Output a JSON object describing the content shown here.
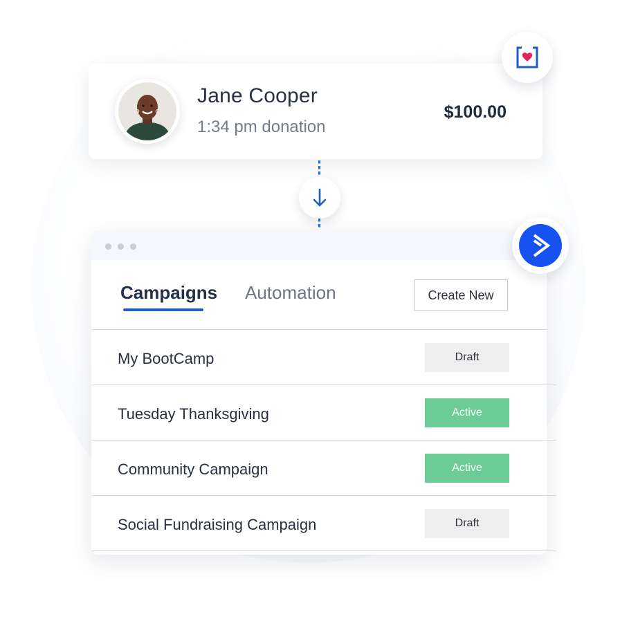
{
  "donation": {
    "donor_name": "Jane Cooper",
    "time_text": "1:34 pm donation",
    "amount": "$100.00"
  },
  "icons": {
    "donation_badge": "heart-box-icon",
    "flow_arrow": "arrow-down-icon",
    "automation_badge": "chevron-right-logo-icon",
    "window_dots": "window-dots-icon"
  },
  "tabs": [
    {
      "label": "Campaigns",
      "active": true
    },
    {
      "label": "Automation",
      "active": false
    }
  ],
  "create_button": "Create New",
  "campaigns": [
    {
      "name": "My BootCamp",
      "status": "Draft"
    },
    {
      "name": "Tuesday Thanksgiving",
      "status": "Active"
    },
    {
      "name": "Community Campaign",
      "status": "Active"
    },
    {
      "name": "Social Fundraising Campaign",
      "status": "Draft"
    }
  ],
  "colors": {
    "accent_blue": "#1f5fbf",
    "logo_blue": "#1652f0",
    "active_green": "#6ccb97",
    "draft_gray": "#eeeeee",
    "heart_red": "#e3245c"
  }
}
